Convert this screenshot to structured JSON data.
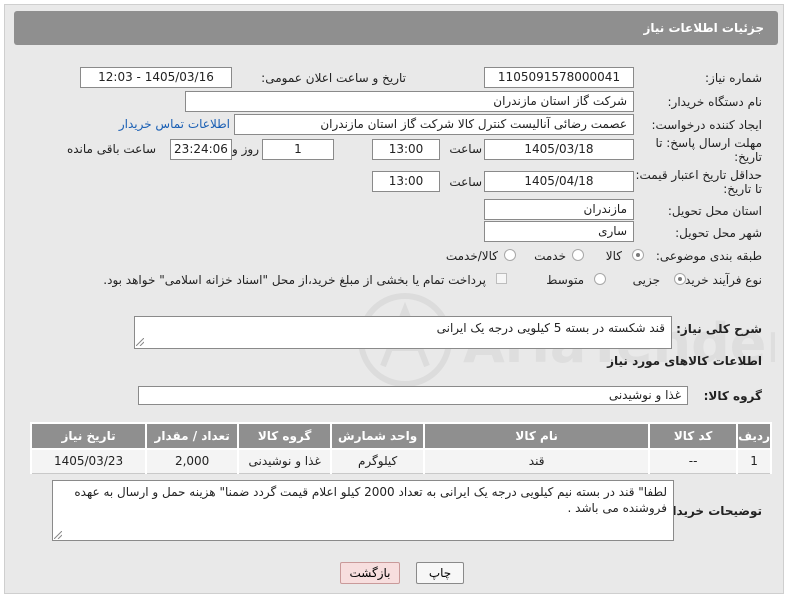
{
  "header": {
    "title": "جزئیات اطلاعات نیاز"
  },
  "form": {
    "need_number_label": "شماره نیاز:",
    "need_number": "1105091578000041",
    "announce_label": "تاریخ و ساعت اعلان عمومی:",
    "announce_value": "1405/03/16 - 12:03",
    "buyer_org_label": "نام دستگاه خریدار:",
    "buyer_org": "شرکت گاز استان مازندران",
    "creator_label": "ایجاد کننده درخواست:",
    "creator": "عصمت رضائی آنالیست کنترل کالا شرکت گاز استان مازندران",
    "buyer_contact_link": "اطلاعات تماس خریدار",
    "reply_deadline_label_1": "مهلت ارسال پاسخ: تا",
    "reply_deadline_label_2": "تاریخ:",
    "reply_date": "1405/03/18",
    "time_label": "ساعت",
    "reply_time": "13:00",
    "days_value": "1",
    "days_label": "روز و",
    "remaining_time": "23:24:06",
    "remaining_label": "ساعت باقی مانده",
    "price_validity_label_1": "حداقل تاریخ اعتبار قیمت:",
    "price_validity_label_2": "تا تاریخ:",
    "price_date": "1405/04/18",
    "price_time": "13:00",
    "province_label": "استان محل تحویل:",
    "province": "مازندران",
    "city_label": "شهر محل تحویل:",
    "city": "ساری",
    "category_label": "طبقه بندی موضوعی:",
    "category_options": [
      "کالا",
      "خدمت",
      "کالا/خدمت"
    ],
    "process_label": "نوع فرآیند خرید :",
    "process_options": [
      "جزیی",
      "متوسط"
    ],
    "payment_note": "پرداخت تمام یا بخشی از مبلغ خرید،از محل \"اسناد خزانه اسلامی\" خواهد بود."
  },
  "description": {
    "label": "شرح کلی نیاز:",
    "text": "قند شکسته  در بسته 5 کیلویی درجه یک ایرانی"
  },
  "goods": {
    "section_title": "اطلاعات کالاهای مورد نیاز",
    "group_label": "گروه کالا:",
    "group_value": "غذا و نوشیدنی",
    "columns": [
      "ردیف",
      "کد کالا",
      "نام کالا",
      "واحد شمارش",
      "گروه کالا",
      "تعداد / مقدار",
      "تاریخ نیاز"
    ],
    "rows": [
      [
        "1",
        "--",
        "قند",
        "کیلوگرم",
        "غذا و نوشیدنی",
        "2,000",
        "1405/03/23"
      ]
    ]
  },
  "buyer_notes": {
    "label": "توضیحات خریدار:",
    "text": "لطفا\" قند در بسته نیم کیلویی درجه یک ایرانی به تعداد 2000 کیلو اعلام قیمت گردد ضمنا\" هزینه حمل و ارسال به عهده فروشنده می باشد ."
  },
  "buttons": {
    "print": "چاپ",
    "back": "بازگشت"
  },
  "watermark": {
    "text": "AriaTender.net"
  },
  "colors": {
    "header_bg": "#8f8f8f",
    "page_bg": "#e9e9e9",
    "link": "#1a5fb4",
    "back_button": "#f7dede"
  }
}
